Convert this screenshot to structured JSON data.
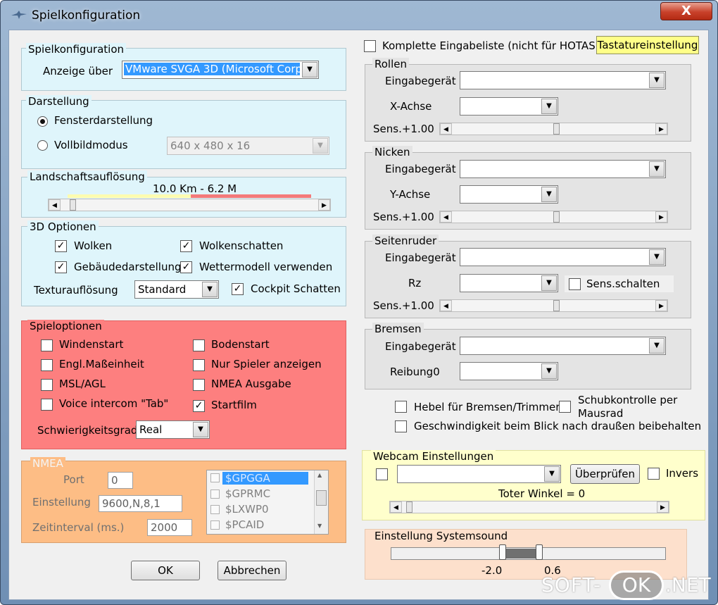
{
  "window": {
    "title": "Spielkonfiguration",
    "close": "X"
  },
  "spielkonfig": {
    "title": "Spielkonfiguration",
    "anzeige_label": "Anzeige über",
    "anzeige_value": "VMware SVGA 3D (Microsoft Corp"
  },
  "darstellung": {
    "title": "Darstellung",
    "fenster": "Fensterdarstellung",
    "vollbild": "Vollbildmodus",
    "resolution": "640 x 480 x 16"
  },
  "landschaft": {
    "title": "Landschaftsauflösung",
    "value": "10.0 Km -   6.2 M"
  },
  "optionen3d": {
    "title": "3D Optionen",
    "wolken": "Wolken",
    "wolkenschatten": "Wolkenschatten",
    "gebaeude": "Gebäudedarstellung",
    "wetter": "Wettermodell verwenden",
    "textur_label": "Texturauflösung",
    "textur_value": "Standard",
    "cockpit": "Cockpit Schatten"
  },
  "spieloptionen": {
    "title": "Spieloptionen",
    "windenstart": "Windenstart",
    "bodenstart": "Bodenstart",
    "engl": "Engl.Maßeinheit",
    "nurspieler": "Nur Spieler anzeigen",
    "msl": "MSL/AGL",
    "nmea": "NMEA Ausgabe",
    "voice": "Voice intercom \"Tab\"",
    "startfilm": "Startfilm",
    "schwierig_label": "Schwierigkeitsgrad",
    "schwierig_value": "Real"
  },
  "nmea": {
    "title": "NMEA",
    "port_label": "Port",
    "port_value": "0",
    "einstellung_label": "Einstellung",
    "einstellung_value": "9600,N,8,1",
    "zeit_label": "Zeitinterval (ms.)",
    "zeit_value": "2000",
    "list": [
      "$GPGGA",
      "$GPRMC",
      "$LXWP0",
      "$PCAID"
    ]
  },
  "buttons": {
    "ok": "OK",
    "abbrechen": "Abbrechen"
  },
  "right": {
    "komplett": "Komplette Eingabeliste (nicht für HOTAS)",
    "tastatur": "Tastatureinstellung"
  },
  "rollen": {
    "title": "Rollen",
    "geraet": "Eingabegerät",
    "achse": "X-Achse",
    "sens": "Sens.+1.00"
  },
  "nicken": {
    "title": "Nicken",
    "geraet": "Eingabegerät",
    "achse": "Y-Achse",
    "sens": "Sens.+1.00"
  },
  "seitenruder": {
    "title": "Seitenruder",
    "geraet": "Eingabegerät",
    "achse": "Rz",
    "sens_schalten": "Sens.schalten",
    "sens": "Sens.+1.00"
  },
  "bremsen": {
    "title": "Bremsen",
    "geraet": "Eingabegerät",
    "reibung": "Reibung0"
  },
  "misc": {
    "hebel": "Hebel für Bremsen/Trimmer",
    "schub1": "Schubkontrolle per",
    "schub2": "Mausrad",
    "geschw": "Geschwindigkeit beim Blick nach draußen beibehalten"
  },
  "webcam": {
    "title": "Webcam Einstellungen",
    "pruefen": "Überprüfen",
    "invers": "Invers",
    "toter": "Toter Winkel = 0"
  },
  "sound": {
    "title": "Einstellung Systemsound",
    "min": "-2.0",
    "max": "0.6"
  },
  "watermark": {
    "a": "SOFT-",
    "b": "OK",
    ".net": ".NET"
  },
  "colors": {
    "red_panel": "#fd7f7f",
    "orange_panel": "#fdbd85",
    "yellow_panel": "#ffffcc",
    "cyan_panel": "#dff5fb",
    "sound_panel": "#fde0cc",
    "gray_panel": "#e4e4e4",
    "highlight": "#3399ff"
  }
}
